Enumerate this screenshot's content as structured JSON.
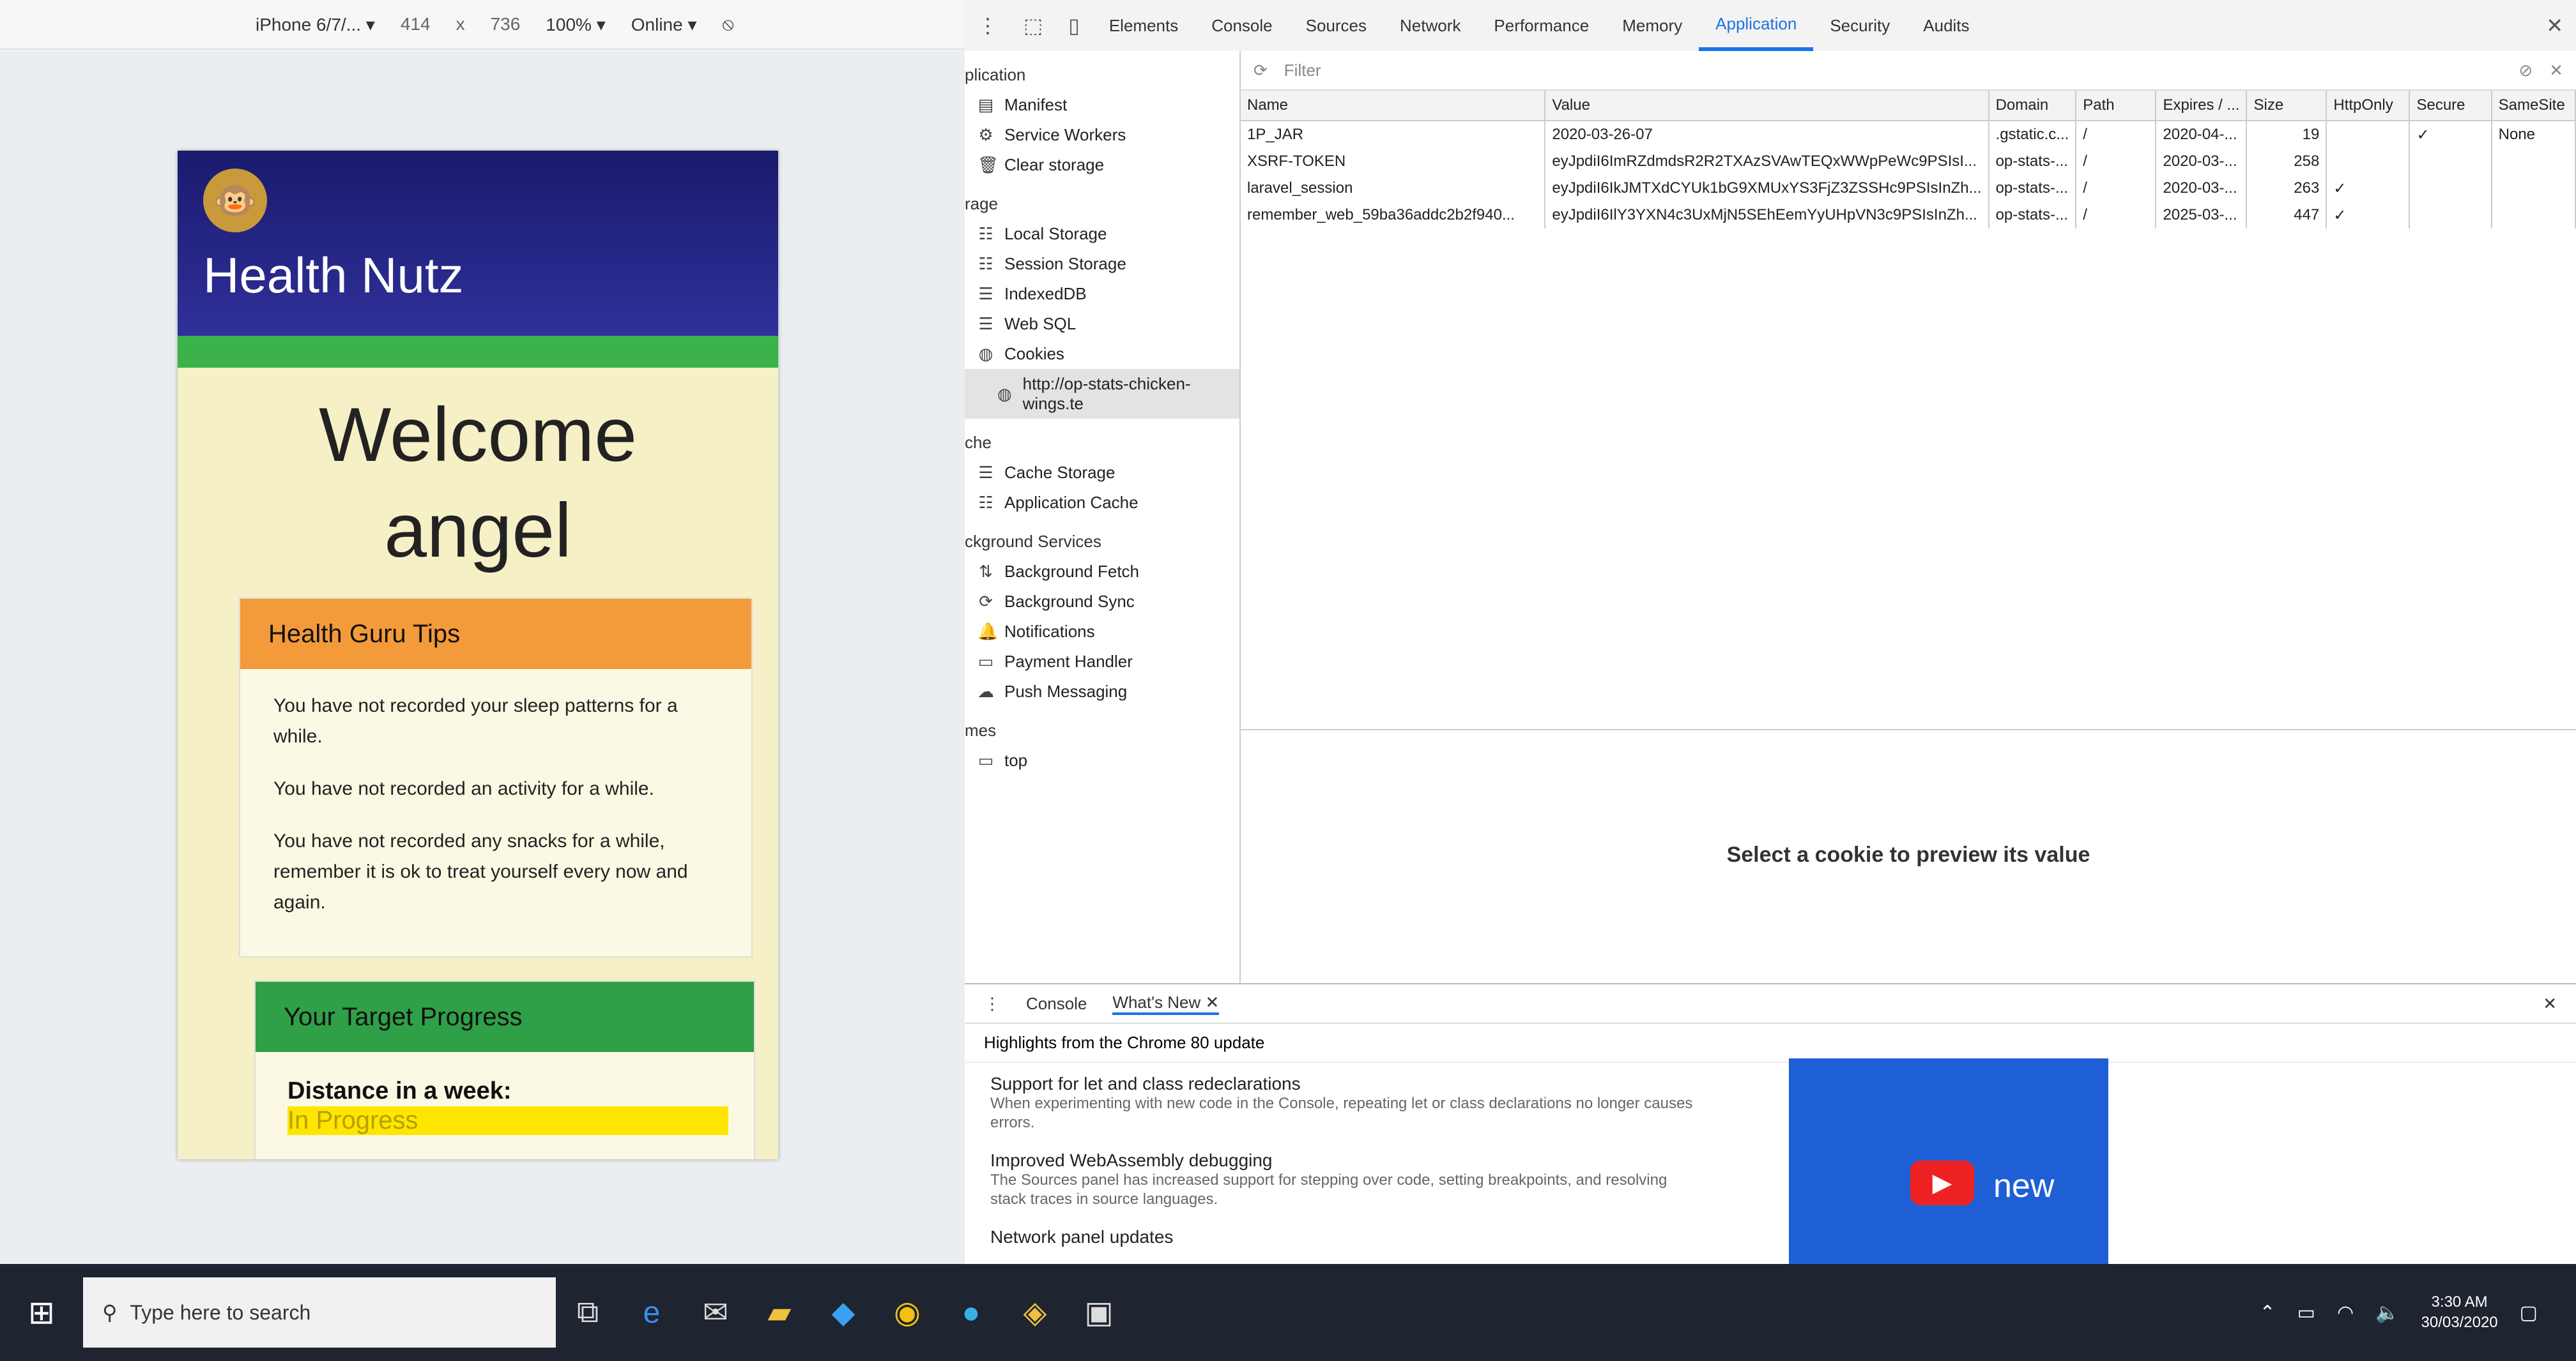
{
  "emulation": {
    "device": "iPhone 6/7/...",
    "width": "414",
    "times": "x",
    "height": "736",
    "zoom": "100%",
    "network": "Online"
  },
  "app": {
    "brand": "Health Nutz",
    "welcome_line1": "Welcome",
    "welcome_line2": "angel",
    "tips_title": "Health Guru Tips",
    "tips": [
      "You have not recorded your sleep patterns for a while.",
      "You have not recorded an activity for a while.",
      "You have not recorded any snacks for a while, remember it is ok to treat yourself every now and again."
    ],
    "progress_title": "Your Target Progress",
    "distance_label": "Distance in a week:",
    "distance_status": "In Progress"
  },
  "devtools": {
    "tabs": [
      "Elements",
      "Console",
      "Sources",
      "Network",
      "Performance",
      "Memory",
      "Application",
      "Security",
      "Audits"
    ],
    "active_tab": "Application",
    "sidebar": {
      "app_section": "plication",
      "app_items": [
        "Manifest",
        "Service Workers",
        "Clear storage"
      ],
      "storage_section": "rage",
      "storage_items": [
        "Local Storage",
        "Session Storage",
        "IndexedDB",
        "Web SQL",
        "Cookies"
      ],
      "cookie_origin": "http://op-stats-chicken-wings.te",
      "cache_section": "che",
      "cache_items": [
        "Cache Storage",
        "Application Cache"
      ],
      "bg_section": "ckground Services",
      "bg_items": [
        "Background Fetch",
        "Background Sync",
        "Notifications",
        "Payment Handler",
        "Push Messaging"
      ],
      "frames_section": "mes",
      "frames_items": [
        "top"
      ]
    },
    "filter_placeholder": "Filter",
    "columns": [
      "Name",
      "Value",
      "Domain",
      "Path",
      "Expires / ...",
      "Size",
      "HttpOnly",
      "Secure",
      "SameSite"
    ],
    "cookies": [
      {
        "name": "1P_JAR",
        "value": "2020-03-26-07",
        "domain": ".gstatic.c...",
        "path": "/",
        "expires": "2020-04-...",
        "size": "19",
        "httponly": "",
        "secure": "✓",
        "samesite": "None"
      },
      {
        "name": "XSRF-TOKEN",
        "value": "eyJpdiI6ImRZdmdsR2R2TXAzSVAwTEQxWWpPeWc9PSIsI...",
        "domain": "op-stats-...",
        "path": "/",
        "expires": "2020-03-...",
        "size": "258",
        "httponly": "",
        "secure": "",
        "samesite": ""
      },
      {
        "name": "laravel_session",
        "value": "eyJpdiI6IkJMTXdCYUk1bG9XMUxYS3FjZ3ZSSHc9PSIsInZh...",
        "domain": "op-stats-...",
        "path": "/",
        "expires": "2020-03-...",
        "size": "263",
        "httponly": "✓",
        "secure": "",
        "samesite": ""
      },
      {
        "name": "remember_web_59ba36addc2b2f940...",
        "value": "eyJpdiI6IlY3YXN4c3UxMjN5SEhEemYyUHpVN3c9PSIsInZh...",
        "domain": "op-stats-...",
        "path": "/",
        "expires": "2025-03-...",
        "size": "447",
        "httponly": "✓",
        "secure": "",
        "samesite": ""
      }
    ],
    "preview_message": "Select a cookie to preview its value",
    "drawer": {
      "tabs": [
        "Console",
        "What's New"
      ],
      "highlights": "Highlights from the Chrome 80 update",
      "features": [
        {
          "title": "Support for let and class redeclarations",
          "desc": "When experimenting with new code in the Console, repeating let or class declarations no longer causes errors."
        },
        {
          "title": "Improved WebAssembly debugging",
          "desc": "The Sources panel has increased support for stepping over code, setting breakpoints, and resolving stack traces in source languages."
        },
        {
          "title": "Network panel updates",
          "desc": ""
        }
      ],
      "video_text": "new"
    }
  },
  "taskbar": {
    "search_placeholder": "Type here to search",
    "time": "3:30 AM",
    "date": "30/03/2020"
  }
}
